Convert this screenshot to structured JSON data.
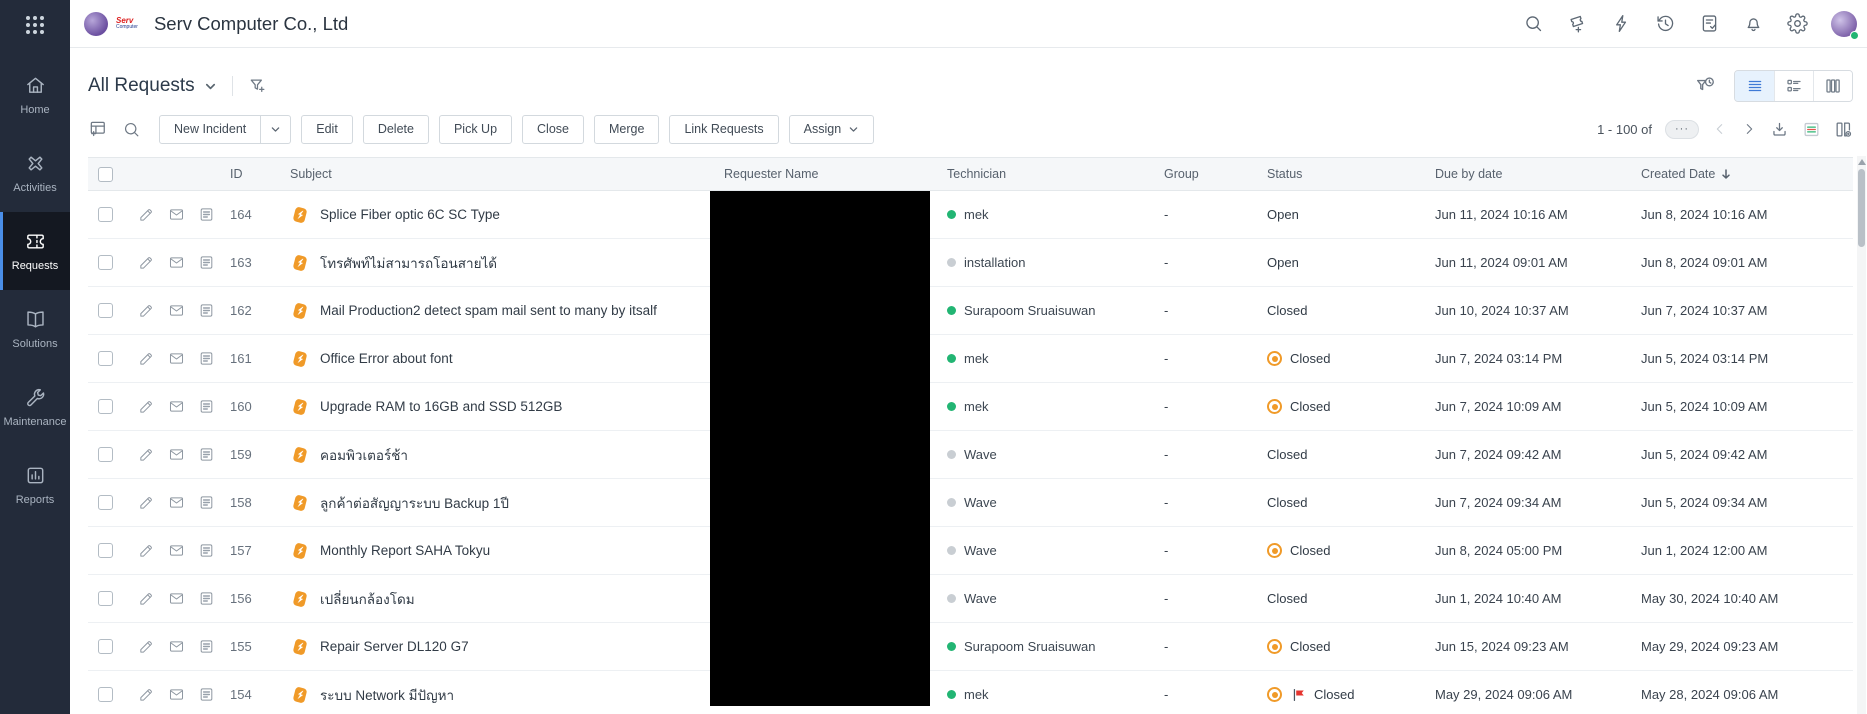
{
  "app": {
    "title": "Serv Computer Co., Ltd",
    "logo_text_primary": "Serv",
    "logo_text_secondary": "Computer"
  },
  "sidebar": {
    "items": [
      {
        "label": "Home",
        "active": false
      },
      {
        "label": "Activities",
        "active": false
      },
      {
        "label": "Requests",
        "active": true
      },
      {
        "label": "Solutions",
        "active": false
      },
      {
        "label": "Maintenance",
        "active": false
      },
      {
        "label": "Reports",
        "active": false
      }
    ]
  },
  "topbar": {
    "icon_names": [
      "search-icon",
      "ticket-add-icon",
      "quick-actions-icon",
      "history-icon",
      "tasks-icon",
      "notifications-icon",
      "settings-icon",
      "user-avatar"
    ]
  },
  "view_header": {
    "selected_view": "All Requests"
  },
  "toolbar": {
    "new_button_label": "New Incident",
    "buttons": [
      "Edit",
      "Delete",
      "Pick Up",
      "Close",
      "Merge",
      "Link Requests"
    ],
    "assign_button_label": "Assign"
  },
  "pagination": {
    "range_label": "1 - 100 of",
    "more_label": "···"
  },
  "table": {
    "columns": [
      "ID",
      "Subject",
      "Requester Name",
      "Technician",
      "Group",
      "Status",
      "Due by date",
      "Created Date"
    ],
    "sort": {
      "column": "Created Date",
      "direction": "desc"
    },
    "redaction": {
      "column": "Requester Name"
    },
    "rows": [
      {
        "id": "164",
        "subject": "Splice Fiber optic 6C SC Type",
        "technician": "mek",
        "technician_online": true,
        "group": "-",
        "status": "Open",
        "status_overdue_icon": false,
        "status_flag_icon": false,
        "due_by": "Jun 11, 2024 10:16 AM",
        "created": "Jun 8, 2024 10:16 AM"
      },
      {
        "id": "163",
        "subject": "โทรศัพท์ไม่สามารถโอนสายได้",
        "technician": "installation",
        "technician_online": false,
        "group": "-",
        "status": "Open",
        "status_overdue_icon": false,
        "status_flag_icon": false,
        "due_by": "Jun 11, 2024 09:01 AM",
        "created": "Jun 8, 2024 09:01 AM"
      },
      {
        "id": "162",
        "subject": "Mail Production2 detect spam mail sent to many by itsalf",
        "technician": "Surapoom Sruaisuwan",
        "technician_online": true,
        "group": "-",
        "status": "Closed",
        "status_overdue_icon": false,
        "status_flag_icon": false,
        "due_by": "Jun 10, 2024 10:37 AM",
        "created": "Jun 7, 2024 10:37 AM"
      },
      {
        "id": "161",
        "subject": "Office Error about font",
        "technician": "mek",
        "technician_online": true,
        "group": "-",
        "status": "Closed",
        "status_overdue_icon": true,
        "status_flag_icon": false,
        "due_by": "Jun 7, 2024 03:14 PM",
        "created": "Jun 5, 2024 03:14 PM"
      },
      {
        "id": "160",
        "subject": "Upgrade RAM to 16GB and SSD 512GB",
        "technician": "mek",
        "technician_online": true,
        "group": "-",
        "status": "Closed",
        "status_overdue_icon": true,
        "status_flag_icon": false,
        "due_by": "Jun 7, 2024 10:09 AM",
        "created": "Jun 5, 2024 10:09 AM"
      },
      {
        "id": "159",
        "subject": "คอมพิวเตอร์ช้า",
        "technician": "Wave",
        "technician_online": false,
        "group": "-",
        "status": "Closed",
        "status_overdue_icon": false,
        "status_flag_icon": false,
        "due_by": "Jun 7, 2024 09:42 AM",
        "created": "Jun 5, 2024 09:42 AM"
      },
      {
        "id": "158",
        "subject": "ลูกค้าต่อสัญญาระบบ Backup 1ปี",
        "technician": "Wave",
        "technician_online": false,
        "group": "-",
        "status": "Closed",
        "status_overdue_icon": false,
        "status_flag_icon": false,
        "due_by": "Jun 7, 2024 09:34 AM",
        "created": "Jun 5, 2024 09:34 AM"
      },
      {
        "id": "157",
        "subject": "Monthly Report SAHA Tokyu",
        "technician": "Wave",
        "technician_online": false,
        "group": "-",
        "status": "Closed",
        "status_overdue_icon": true,
        "status_flag_icon": false,
        "due_by": "Jun 8, 2024 05:00 PM",
        "created": "Jun 1, 2024 12:00 AM"
      },
      {
        "id": "156",
        "subject": "เปลี่ยนกล้องโดม",
        "technician": "Wave",
        "technician_online": false,
        "group": "-",
        "status": "Closed",
        "status_overdue_icon": false,
        "status_flag_icon": false,
        "due_by": "Jun 1, 2024 10:40 AM",
        "created": "May 30, 2024 10:40 AM"
      },
      {
        "id": "155",
        "subject": "Repair Server DL120 G7",
        "technician": "Surapoom Sruaisuwan",
        "technician_online": true,
        "group": "-",
        "status": "Closed",
        "status_overdue_icon": true,
        "status_flag_icon": false,
        "due_by": "Jun 15, 2024 09:23 AM",
        "created": "May 29, 2024 09:23 AM"
      },
      {
        "id": "154",
        "subject": "ระบบ Network มีปัญหา",
        "technician": "mek",
        "technician_online": true,
        "group": "-",
        "status": "Closed",
        "status_overdue_icon": true,
        "status_flag_icon": true,
        "due_by": "May 29, 2024 09:06 AM",
        "created": "May 28, 2024 09:06 AM"
      }
    ]
  },
  "colors": {
    "accent_blue": "#3F7AD6",
    "status_orange": "#F09A28",
    "online_green": "#22B573",
    "flag_red": "#E5342E",
    "sidebar_bg": "#232B3A"
  }
}
